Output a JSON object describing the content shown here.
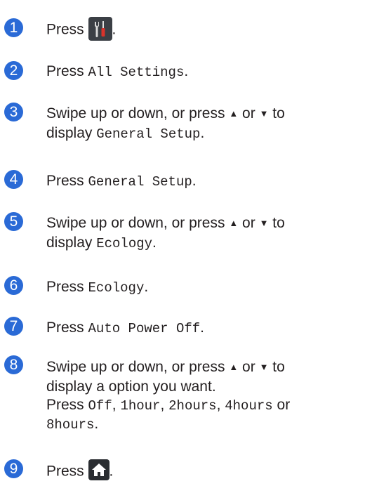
{
  "steps": [
    {
      "number": "1",
      "press": "Press",
      "period": "."
    },
    {
      "number": "2",
      "press": "Press",
      "item": "All Settings",
      "period": "."
    },
    {
      "number": "3",
      "line1": "Swipe up or down, or press",
      "up": "▲",
      "or": "or",
      "down": "▼",
      "to": "to",
      "line2": "display",
      "item": "General Setup",
      "period": "."
    },
    {
      "number": "4",
      "press": "Press",
      "item": "General Setup",
      "period": "."
    },
    {
      "number": "5",
      "line1": "Swipe up or down, or press",
      "up": "▲",
      "or": "or",
      "down": "▼",
      "to": "to",
      "line2": "display",
      "item": "Ecology",
      "period": "."
    },
    {
      "number": "6",
      "press": "Press",
      "item": "Ecology",
      "period": "."
    },
    {
      "number": "7",
      "press": "Press",
      "item": "Auto Power Off",
      "period": "."
    },
    {
      "number": "8",
      "line1": "Swipe up or down, or press",
      "up": "▲",
      "or": "or",
      "down": "▼",
      "to": "to",
      "line2": "display a option you want.",
      "press": "Press",
      "options": [
        "Off",
        "1hour",
        "2hours",
        "4hours",
        "8hours"
      ],
      "comma": ",",
      "or_word": "or",
      "period": "."
    },
    {
      "number": "9",
      "press": "Press",
      "period": "."
    }
  ],
  "icons": {
    "settings": "settings-tools-icon",
    "home": "home-icon"
  },
  "colors": {
    "badge": "#2a6ad6",
    "screwdriver_handle": "#d9332b"
  }
}
